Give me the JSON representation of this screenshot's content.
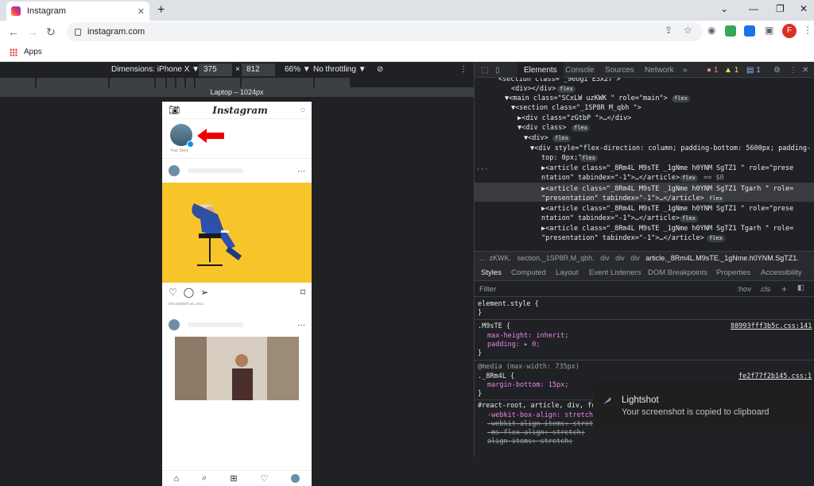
{
  "browser": {
    "tab_title": "Instagram",
    "tab_close": "✕",
    "new_tab": "+",
    "url": "instagram.com",
    "bookmark_apps": "Apps",
    "profile_initial": "F"
  },
  "device_toolbar": {
    "dimensions_label": "Dimensions: iPhone X ▼",
    "width": "375",
    "times": "×",
    "height": "812",
    "zoom": "66% ▼",
    "throttling": "No throttling ▼",
    "laptop_label": "Laptop – 1024px"
  },
  "instagram": {
    "logo": "Instagram",
    "your_story": "Your Story",
    "more": "···",
    "post_date": "DECEMBER 28, 2021"
  },
  "devtools": {
    "tabs": [
      "Elements",
      "Console",
      "Sources",
      "Network",
      "»"
    ],
    "errors": "1",
    "warnings": "1",
    "messages": "1",
    "breadcrumbs": [
      "...",
      "zKWK.",
      "section._1SP8R.M_qbh.",
      "div",
      "div",
      "div",
      "article._8Rm4L.M9sTE._1gNme.h0YNM.SgTZ1."
    ],
    "sub_tabs": [
      "Styles",
      "Computed",
      "Layout",
      "Event Listeners",
      "DOM Breakpoints",
      "Properties",
      "Accessibility"
    ],
    "filter_placeholder": "Filter",
    "hov": ":hov",
    "cls": ".cls",
    "dom_lines": [
      {
        "text": "<section class=\"_9eogI E3X2T\">"
      },
      {
        "text": "<div></div>"
      },
      {
        "text": "▼<main class=\"SCxLW uzKWK  \" role=\"main\">"
      },
      {
        "text": "▼<section class=\"_1SP8R   M_qbh \">"
      },
      {
        "text": "▶<div class=\"zGtbP  \">…</div>"
      },
      {
        "text": "▼<div class>"
      },
      {
        "text": "▼<div>"
      },
      {
        "text": "▼<div style=\"flex-direction: column; padding-bottom: 5600px; padding-"
      },
      {
        "text": "top: 0px;\">"
      },
      {
        "text": "▶<article class=\"_8Rm4L  M9sTE _1gNme h0YNM  SgTZ1    \" role=\"prese"
      },
      {
        "text": "ntation\" tabindex=\"-1\">…</article>"
      },
      {
        "text": "▶<article class=\"_8Rm4L  M9sTE _1gNme h0YNM  SgTZ1  Tgarh  \" role="
      },
      {
        "text": "\"presentation\" tabindex=\"-1\">…</article>"
      },
      {
        "text": "▶<article class=\"_8Rm4L  M9sTE _1gNme h0YNM  SgTZ1    \" role=\"prese"
      },
      {
        "text": "ntation\" tabindex=\"-1\">…</article>"
      },
      {
        "text": "▶<article class=\"_8Rm4L  M9sTE _1gNme h0YNM  SgTZ1  Tgarh  \" role="
      },
      {
        "text": "\"presentation\" tabindex=\"-1\">…</article>"
      }
    ],
    "pill_flex": "flex",
    "eq0": "== $0",
    "styles": {
      "element_style": "element.style {",
      "close": "}",
      "rule1_selector": ".M9sTE {",
      "rule1_link": "88993fff3b5c.css:141",
      "rule1_p1": "max-height: inherit;",
      "rule1_p2": "padding: ▸ 0;",
      "media": "@media (max-width: 735px)",
      "rule2_selector": "._8Rm4L {",
      "rule2_link": "fe2f77f2b145.css:1",
      "rule2_p1": "margin-bottom: 15px;",
      "rule3_selector": "#react-root, article, div, fo",
      "rule3_p1": "-webkit-box-align: stretch;",
      "rule3_p2": "-webkit-align-items: stretch",
      "rule3_p3": "-ms-flex-align: stretch;",
      "rule3_p4": "align-items: stretch;"
    }
  },
  "toast": {
    "title": "Lightshot",
    "message": "Your screenshot is copied to clipboard"
  }
}
